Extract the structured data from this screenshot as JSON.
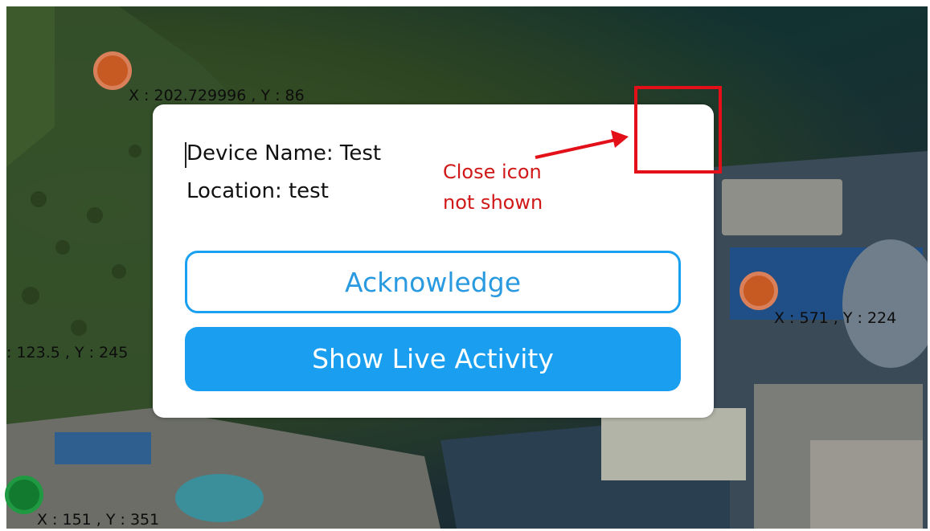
{
  "markers": [
    {
      "id": "marker-1",
      "color": "#c65a22",
      "label": "X : 202.729996 , Y : 86"
    },
    {
      "id": "marker-2",
      "color": "#c65a22",
      "label": "X : 571 , Y : 224"
    },
    {
      "id": "marker-3",
      "color": "#7a9a5a",
      "label": ": 123.5 , Y : 245"
    },
    {
      "id": "marker-4",
      "color": "#127a2e",
      "label": "X : 151 , Y : 351"
    }
  ],
  "popup": {
    "device_name": "Device Name: Test",
    "location": "Location: test",
    "acknowledge_label": "Acknowledge",
    "live_activity_label": "Show Live Activity",
    "accent_color": "#1a9ff0"
  },
  "annotation": {
    "line1": "Close icon",
    "line2": "not shown",
    "color": "#e3101a"
  }
}
